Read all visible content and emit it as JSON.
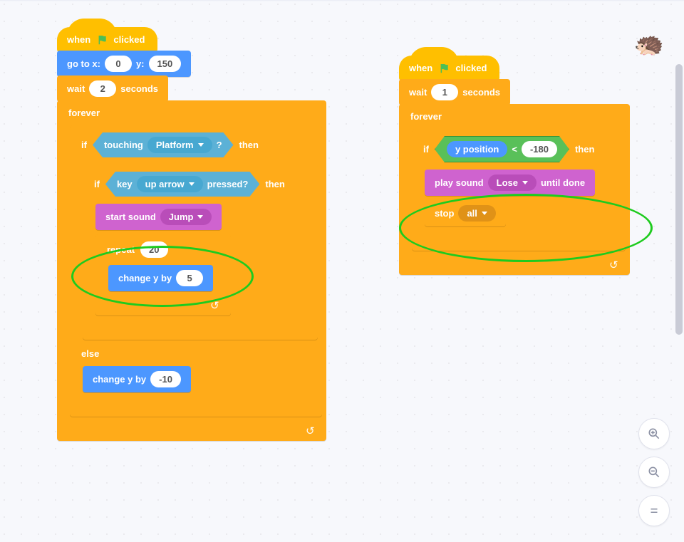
{
  "sprite_thumbnail": {
    "name": "hedgehog",
    "glyph": "🦔"
  },
  "zoom": {
    "in_title": "Zoom in",
    "out_title": "Zoom out",
    "reset_title": "Reset zoom"
  },
  "left": {
    "hat_when": "when",
    "hat_clicked": "clicked",
    "goto_prefix": "go to x:",
    "goto_y": "y:",
    "goto_x_val": "0",
    "goto_y_val": "150",
    "wait_prefix": "wait",
    "wait_val": "2",
    "wait_suffix": "seconds",
    "forever": "forever",
    "if": "if",
    "then": "then",
    "else": "else",
    "touching_prefix": "touching",
    "touching_arg": "Platform",
    "touching_suffix": "?",
    "key_prefix": "key",
    "key_arg": "up arrow",
    "key_suffix": "pressed?",
    "start_sound": "start sound",
    "start_sound_arg": "Jump",
    "repeat": "repeat",
    "repeat_val": "20",
    "change_y": "change y by",
    "change_y_val_up": "5",
    "change_y_val_down": "-10"
  },
  "right": {
    "hat_when": "when",
    "hat_clicked": "clicked",
    "wait_prefix": "wait",
    "wait_val": "1",
    "wait_suffix": "seconds",
    "forever": "forever",
    "if": "if",
    "then": "then",
    "ypos": "y position",
    "lt": "<",
    "thresh": "-180",
    "play_sound": "play sound",
    "play_sound_arg": "Lose",
    "play_sound_suffix": "until done",
    "stop": "stop",
    "stop_arg": "all"
  }
}
